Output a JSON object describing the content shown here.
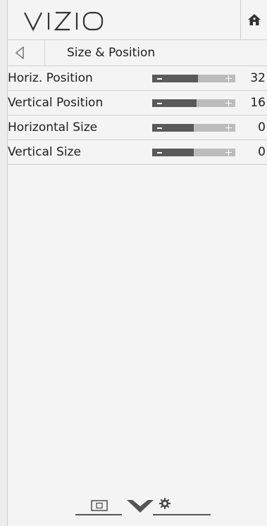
{
  "header": {
    "logo_text": "VIZIO",
    "home_icon": "home-icon"
  },
  "breadcrumb": {
    "back_icon": "back-arrow-icon",
    "title": "Size & Position"
  },
  "settings": [
    {
      "label": "Horiz. Position",
      "value": "32",
      "level": 0.55
    },
    {
      "label": "Vertical Position",
      "value": "16",
      "level": 0.53
    },
    {
      "label": "Horizontal Size",
      "value": "0",
      "level": 0.5
    },
    {
      "label": "Vertical Size",
      "value": "0",
      "level": 0.5
    }
  ],
  "bottom_nav": {
    "icons": [
      "picture-icon",
      "vizio-v-icon",
      "gear-icon"
    ]
  },
  "colors": {
    "panel_bg": "#f4f4f4",
    "slider_fill": "#5a5a5a",
    "slider_track": "#bcbcbc"
  }
}
